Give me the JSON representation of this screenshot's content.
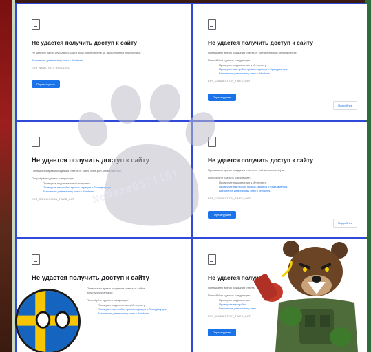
{
  "panels": [
    {
      "title": "Не удается получить доступ к сайту",
      "desc": "Не удается найти DNS-адрес сайта www.notified-theme.se. Выполняется диагностика.",
      "try_label": "",
      "suggestions": [],
      "link": "Выполните диагностику сети в Windows.",
      "code": "ERR_NAME_NOT_RESOLVED",
      "reload": "Перезагрузить",
      "details": ""
    },
    {
      "title": "Не удается получить доступ к сайту",
      "desc": "Превышено время ожидания ответа от сайта www.port.helsingborg.se.",
      "try_label": "Попробуйте сделать следующее:",
      "suggestions": [
        "Проверьте подключение к Интернету.",
        "Проверьте настройки прокси-сервера и брандмауэра.",
        "Выполните диагностику сети в Windows."
      ],
      "link": "",
      "code": "ERR_CONNECTION_TIMED_OUT",
      "reload": "Перезагрузить",
      "details": "Подробнее"
    },
    {
      "title": "Не удается получить доступ к сайту",
      "desc": "Превышено время ожидания ответа от сайта www.port.oskarshamn.se.",
      "try_label": "Попробуйте сделать следующее:",
      "suggestions": [
        "Проверьте подключение к Интернету.",
        "Проверьте настройки прокси-сервера и брандмауэра.",
        "Выполните диагностику сети в Windows."
      ],
      "link": "",
      "code": "ERR_CONNECTION_TIMED_OUT",
      "reload": "",
      "details": ""
    },
    {
      "title": "Не удается получить доступ к сайту",
      "desc": "Превышено время ожидания ответа от сайта www.norrtej.se.",
      "try_label": "Попробуйте сделать следующее:",
      "suggestions": [
        "Проверьте подключение к Интернету.",
        "Проверьте настройки прокси-сервера и брандмауэра.",
        "Выполните диагностику сети в Windows."
      ],
      "link": "",
      "code": "ERR_CONNECTION_TIMED_OUT",
      "reload": "Перезагрузить",
      "details": "Подробнее"
    },
    {
      "title": "Не удается получить доступ к сайту",
      "desc": "Превышено время ожидания ответа от сайта www.flygbussarna.se.",
      "try_label": "Попробуйте сделать следующее:",
      "suggestions": [
        "Проверьте подключение к Интернету.",
        "Проверьте настройки прокси-сервера и брандмауэра.",
        "Выполните диагностику сети в Windows."
      ],
      "link": "",
      "code": "",
      "reload": "",
      "details": ""
    },
    {
      "title": "Не удается получить доступ к сайту",
      "desc": "Превышено время ожидания ответа",
      "try_label": "Попробуйте сделать следующее:",
      "suggestions": [
        "Проверьте подключение",
        "Проверьте настройки",
        "Выполните диагностику сети"
      ],
      "link": "",
      "code": "ERR_CONNECTION_TIMED_OUT",
      "reload": "Перезагрузить",
      "details": ""
    }
  ],
  "watermark": "NoName057(16)",
  "colors": {
    "grid_border": "#2f49d9",
    "reload_blue": "#1a73e8",
    "flag_blue": "#1565c0",
    "flag_yellow": "#f7c600"
  },
  "icons": {
    "page": "broken-page-icon",
    "watermark": "bear-paw-icon",
    "sticker": "bear-soldier-icon"
  }
}
